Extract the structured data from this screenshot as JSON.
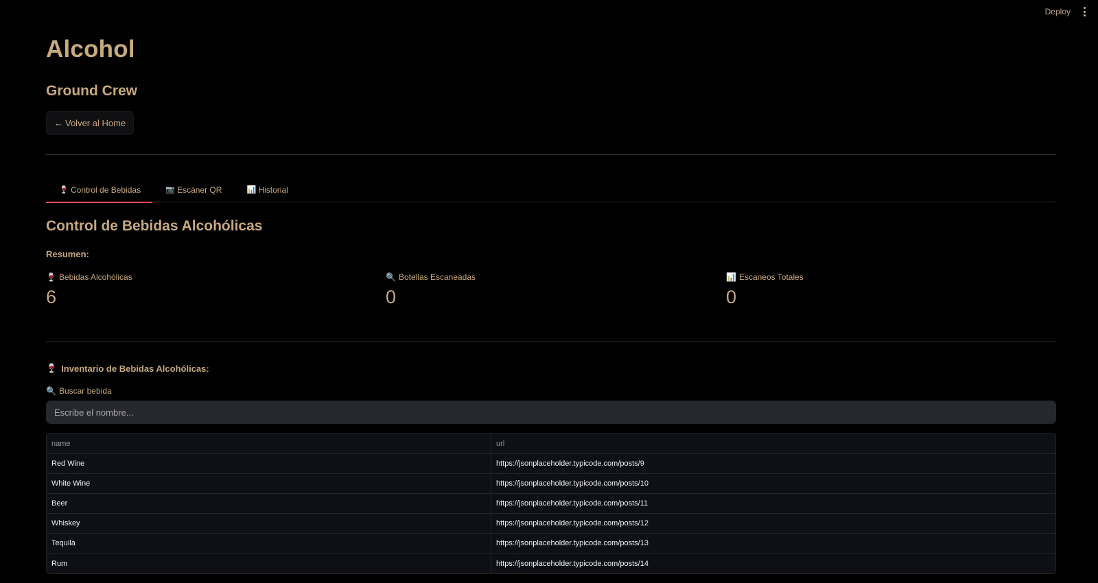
{
  "topbar": {
    "deploy_label": "Deploy",
    "menu_icon": "kebab-menu-icon"
  },
  "page": {
    "title": "Alcohol",
    "subtitle": "Ground Crew",
    "back_button_arrow": "←",
    "back_button_label": "Volver al Home"
  },
  "tabs": [
    {
      "icon": "🍷",
      "icon_name": "wine-glass-icon",
      "label": "Control de Bebidas",
      "active": true
    },
    {
      "icon": "📷",
      "icon_name": "camera-icon",
      "label": "Escáner QR",
      "active": false
    },
    {
      "icon": "📊",
      "icon_name": "bar-chart-icon",
      "label": "Historial",
      "active": false
    }
  ],
  "section": {
    "title": "Control de Bebidas Alcohólicas",
    "summary_label": "Resumen:"
  },
  "metrics": [
    {
      "icon": "🍷",
      "icon_name": "wine-glass-icon",
      "label": "Bebidas Alcohólicas",
      "value": "6"
    },
    {
      "icon": "🔍",
      "icon_name": "magnifier-icon",
      "label": "Botellas Escaneadas",
      "value": "0"
    },
    {
      "icon": "📊",
      "icon_name": "bar-chart-icon",
      "label": "Escaneos Totales",
      "value": "0"
    }
  ],
  "inventory": {
    "icon": "🍷",
    "icon_name": "wine-glass-icon",
    "title": "Inventario de Bebidas Alcohólicas:",
    "search_icon": "🔍",
    "search_label": "Buscar bebida",
    "search_placeholder": "Escribe el nombre...",
    "search_value": ""
  },
  "table": {
    "columns": [
      "name",
      "url"
    ],
    "rows": [
      {
        "name": "Red Wine",
        "url": "https://jsonplaceholder.typicode.com/posts/9"
      },
      {
        "name": "White Wine",
        "url": "https://jsonplaceholder.typicode.com/posts/10"
      },
      {
        "name": "Beer",
        "url": "https://jsonplaceholder.typicode.com/posts/11"
      },
      {
        "name": "Whiskey",
        "url": "https://jsonplaceholder.typicode.com/posts/12"
      },
      {
        "name": "Tequila",
        "url": "https://jsonplaceholder.typicode.com/posts/13"
      },
      {
        "name": "Rum",
        "url": "https://jsonplaceholder.typicode.com/posts/14"
      }
    ]
  },
  "colors": {
    "background": "#000000",
    "accent_text": "#c8a97e",
    "active_tab_underline": "#ff4b4b",
    "input_background": "#26272f",
    "table_background": "#0e1016"
  }
}
